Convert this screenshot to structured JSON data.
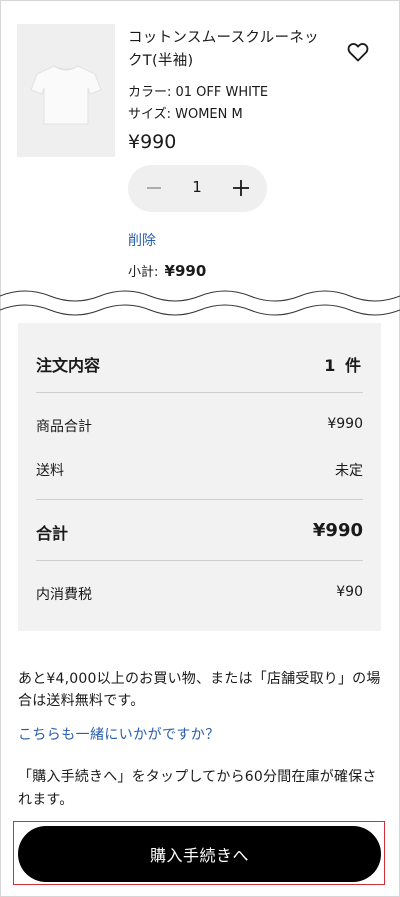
{
  "product": {
    "name": "コットンスムースクルーネックT(半袖)",
    "color": "カラー: 01 OFF WHITE",
    "size": "サイズ: WOMEN M",
    "price": "¥990",
    "quantity": "1",
    "delete_label": "削除",
    "subtotal_label": "小計:",
    "subtotal_value": "¥990"
  },
  "summary": {
    "title": "注文内容",
    "count": "1 件",
    "goods_label": "商品合計",
    "goods_value": "¥990",
    "shipping_label": "送料",
    "shipping_value": "未定",
    "total_label": "合計",
    "total_value": "¥990",
    "tax_label": "内消費税",
    "tax_value": "¥90"
  },
  "notes": {
    "free_shipping": "あと¥4,000以上のお買い物、または「店舗受取り」の場合は送料無料です。",
    "suggest_link": "こちらも一緒にいかがですか？",
    "stock_note": "「購入手続きへ」をタップしてから60分間在庫が確保されます。"
  },
  "checkout": {
    "label": "購入手続きへ"
  },
  "icons": {
    "favorite": "heart-icon",
    "decrease": "minus-icon",
    "increase": "plus-icon"
  },
  "colors": {
    "link": "#2a5fae",
    "summary_bg": "#f2f2f2",
    "button_bg": "#000000",
    "highlight": "#d32f3a"
  }
}
